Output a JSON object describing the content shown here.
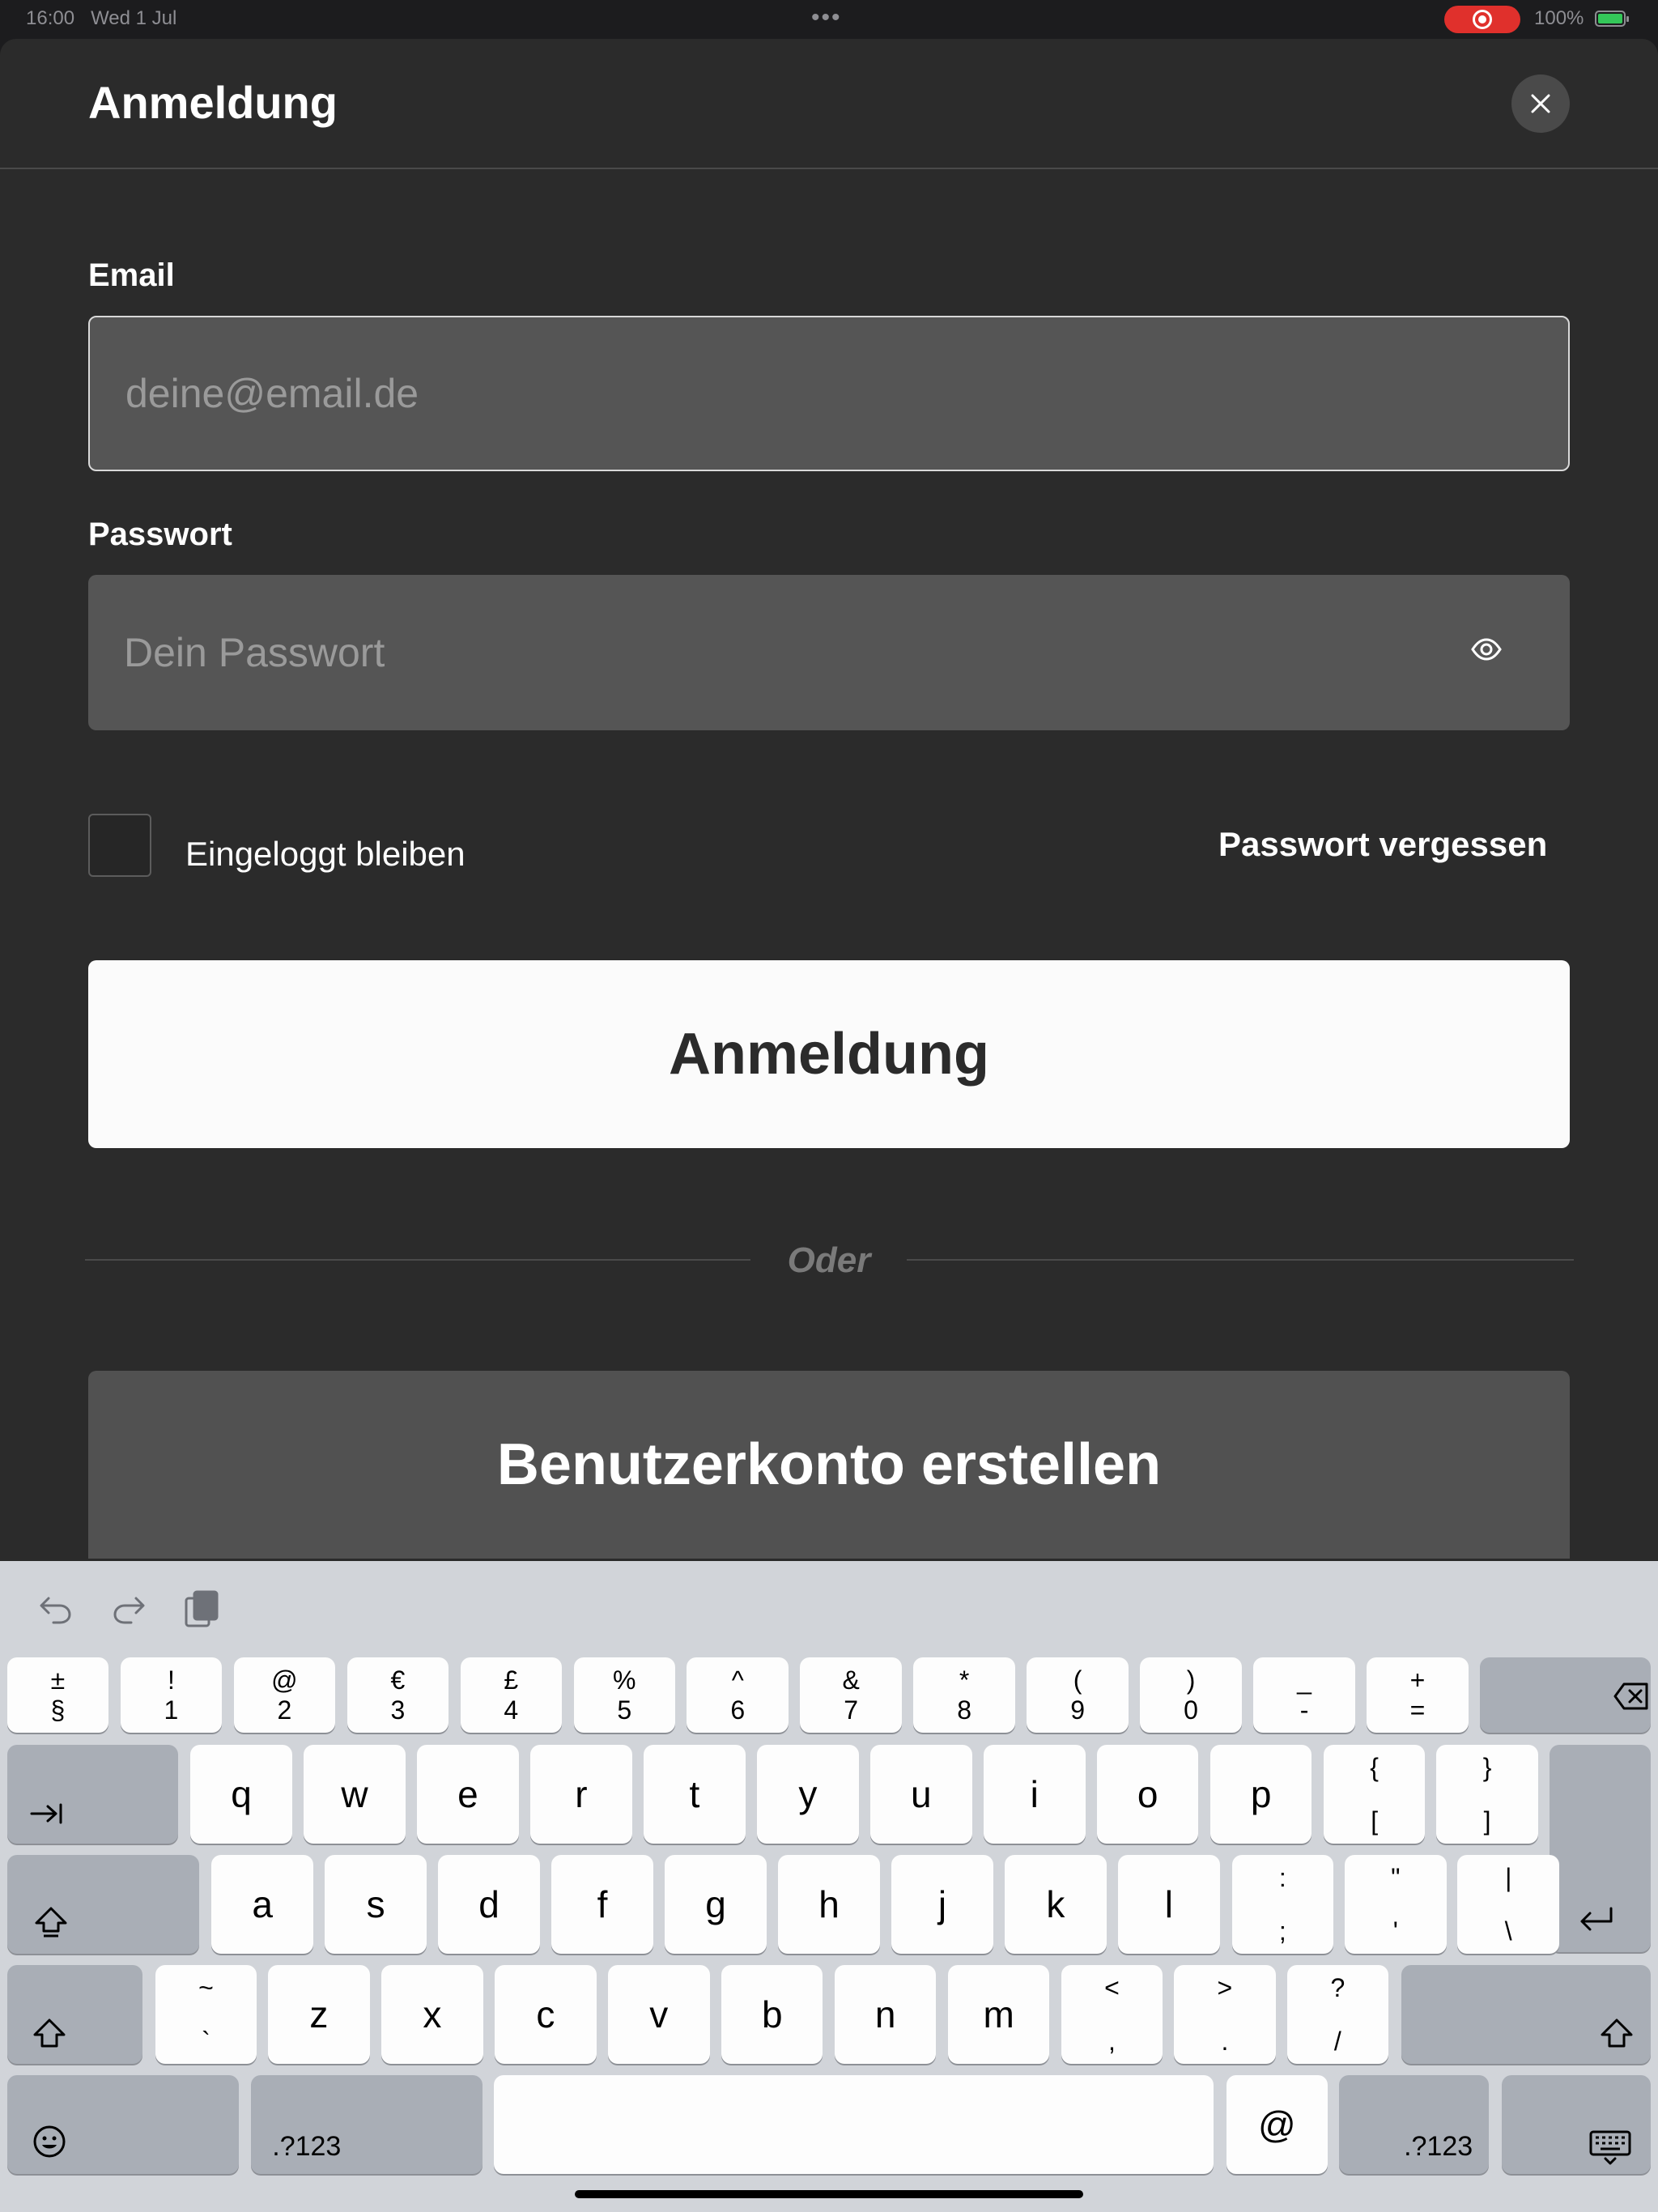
{
  "status_bar": {
    "time": "16:00",
    "date": "Wed 1 Jul",
    "battery": "100%",
    "colors": {
      "record": "#e0302c",
      "battery": "#34c759"
    }
  },
  "sheet": {
    "title": "Anmeldung",
    "close_icon": "close-icon"
  },
  "form": {
    "email_label": "Email",
    "email_placeholder": "deine@email.de",
    "email_value": "",
    "password_label": "Passwort",
    "password_placeholder": "Dein Passwort",
    "password_value": "",
    "remember_label": "Eingeloggt bleiben",
    "remember_checked": false,
    "forgot_label": "Passwort vergessen",
    "login_button": "Anmeldung",
    "divider_text": "Oder",
    "create_button": "Benutzerkonto erstellen"
  },
  "keyboard": {
    "toolbar": [
      "undo-icon",
      "redo-icon",
      "clipboard-icon"
    ],
    "number_row": [
      {
        "top": "±",
        "bottom": "§"
      },
      {
        "top": "!",
        "bottom": "1"
      },
      {
        "top": "@",
        "bottom": "2"
      },
      {
        "top": "€",
        "bottom": "3"
      },
      {
        "top": "£",
        "bottom": "4"
      },
      {
        "top": "%",
        "bottom": "5"
      },
      {
        "top": "^",
        "bottom": "6"
      },
      {
        "top": "&",
        "bottom": "7"
      },
      {
        "top": "*",
        "bottom": "8"
      },
      {
        "top": "(",
        "bottom": "9"
      },
      {
        "top": ")",
        "bottom": "0"
      },
      {
        "top": "_",
        "bottom": "-"
      },
      {
        "top": "+",
        "bottom": "="
      }
    ],
    "row_q": [
      "q",
      "w",
      "e",
      "r",
      "t",
      "y",
      "u",
      "i",
      "o",
      "p"
    ],
    "row_q_extra": [
      {
        "top": "{",
        "bottom": "["
      },
      {
        "top": "}",
        "bottom": "]"
      }
    ],
    "row_a": [
      "a",
      "s",
      "d",
      "f",
      "g",
      "h",
      "j",
      "k",
      "l"
    ],
    "row_a_extra": [
      {
        "top": ":",
        "bottom": ";"
      },
      {
        "top": "\"",
        "bottom": "'"
      },
      {
        "top": "|",
        "bottom": "\\"
      }
    ],
    "row_z_first": {
      "top": "~",
      "bottom": "`"
    },
    "row_z": [
      "z",
      "x",
      "c",
      "v",
      "b",
      "n",
      "m"
    ],
    "row_z_extra": [
      {
        "top": "<",
        "bottom": ","
      },
      {
        "top": ">",
        "bottom": "."
      },
      {
        "top": "?",
        "bottom": "/"
      }
    ],
    "numbers_label": ".?123",
    "at_key": "@"
  }
}
